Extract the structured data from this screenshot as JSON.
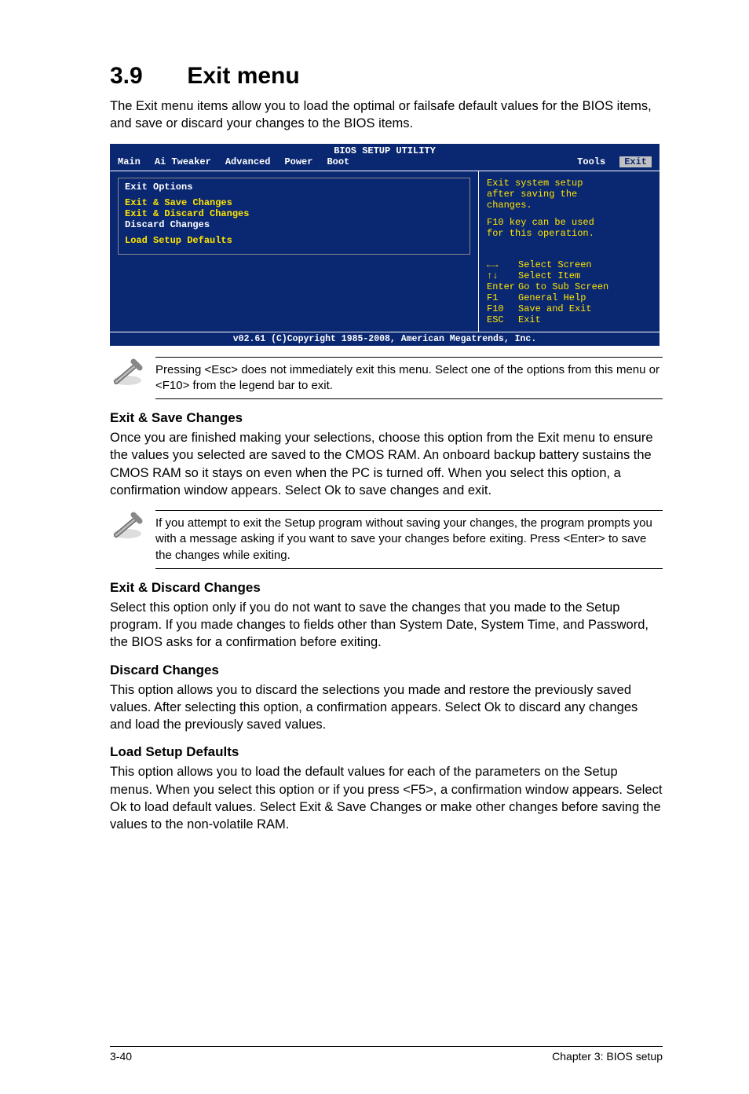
{
  "section": {
    "num": "3.9",
    "title": "Exit menu"
  },
  "intro": "The Exit menu items allow you to load the optimal or failsafe default values for the BIOS items, and save or discard your changes to the BIOS items.",
  "bios": {
    "title": "BIOS SETUP UTILITY",
    "tabs": [
      "Main",
      "Ai Tweaker",
      "Advanced",
      "Power",
      "Boot",
      "Tools",
      "Exit"
    ],
    "selected_tab": "Exit",
    "heading": "Exit Options",
    "items": [
      "Exit & Save Changes",
      "Exit & Discard Changes",
      "Discard Changes",
      "Load Setup Defaults"
    ],
    "help": {
      "l1": "Exit system setup",
      "l2": "after saving the",
      "l3": "changes.",
      "l4": "F10 key can be used",
      "l5": "for this operation."
    },
    "keys": [
      {
        "k": "lr",
        "label": "Select Screen"
      },
      {
        "k": "ud",
        "label": "Select Item"
      },
      {
        "k": "Enter",
        "label": "Go to Sub Screen"
      },
      {
        "k": "F1",
        "label": "General Help"
      },
      {
        "k": "F10",
        "label": "Save and Exit"
      },
      {
        "k": "ESC",
        "label": "Exit"
      }
    ],
    "copyright": "v02.61 (C)Copyright 1985-2008, American Megatrends, Inc."
  },
  "note1": "Pressing <Esc> does not immediately exit this menu. Select one of the options from this menu or <F10> from the legend bar to exit.",
  "s1": {
    "h": "Exit & Save Changes",
    "p": "Once you are finished making your selections, choose this option from the Exit menu to ensure the values you selected are saved to the CMOS RAM. An onboard backup battery sustains the CMOS RAM so it stays on even when the PC is turned off. When you select this option, a confirmation window appears. Select Ok to save changes and exit."
  },
  "note2": "If you attempt to exit the Setup program without saving your changes, the program prompts you with a message asking if you want to save your changes before exiting. Press <Enter> to save the changes while exiting.",
  "s2": {
    "h": "Exit & Discard Changes",
    "p": "Select this option only if you do not want to save the changes that you  made to the Setup program. If you made changes to fields other than System Date, System Time, and Password, the BIOS asks for a confirmation before exiting."
  },
  "s3": {
    "h": "Discard Changes",
    "p": "This option allows you to discard the selections you made and restore the previously saved values. After selecting this option, a confirmation appears. Select Ok to discard any changes and load the previously saved values."
  },
  "s4": {
    "h": "Load Setup Defaults",
    "p": "This option allows you to load the default values for each of the parameters on the Setup menus. When you select this option or if you press <F5>, a confirmation window appears. Select Ok to load default values. Select Exit & Save Changes or make other changes before saving the values to the non-volatile RAM."
  },
  "footer": {
    "left": "3-40",
    "right": "Chapter 3: BIOS setup"
  }
}
